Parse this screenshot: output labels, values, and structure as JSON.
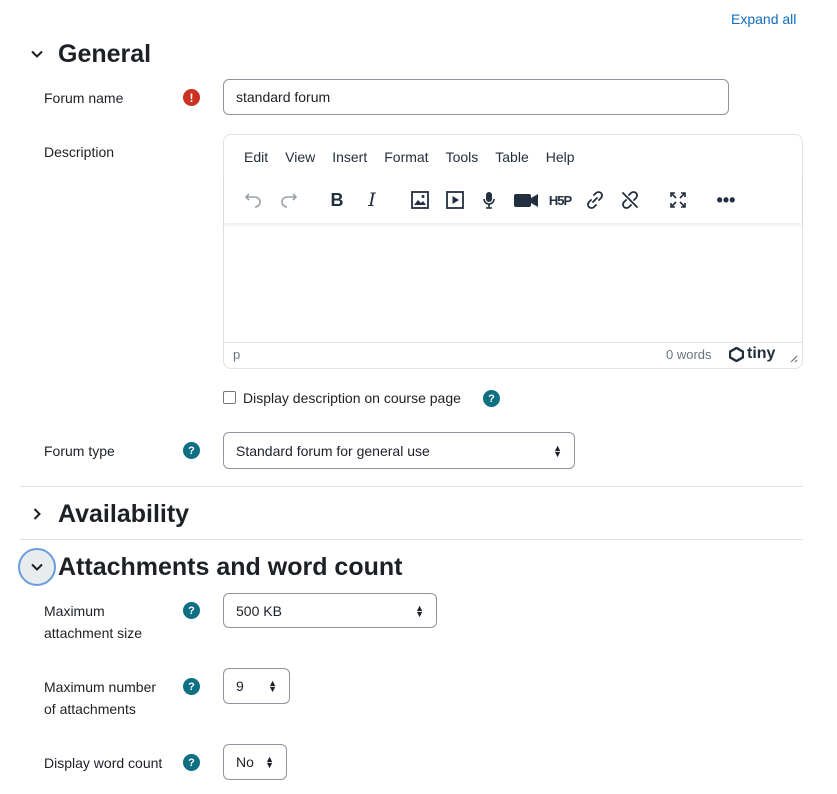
{
  "expand_all": "Expand all",
  "sections": {
    "general": {
      "title": "General"
    },
    "availability": {
      "title": "Availability"
    },
    "attachments": {
      "title": "Attachments and word count"
    }
  },
  "general": {
    "forum_name": {
      "label": "Forum name",
      "value": "standard forum"
    },
    "description": {
      "label": "Description",
      "menu": [
        "Edit",
        "View",
        "Insert",
        "Format",
        "Tools",
        "Table",
        "Help"
      ],
      "toolbar_icons": [
        "undo-icon",
        "redo-icon",
        "bold-icon",
        "italic-icon",
        "image-icon",
        "media-icon",
        "microphone-icon",
        "video-camera-icon",
        "h5p-icon",
        "link-icon",
        "unlink-icon",
        "fullscreen-icon",
        "more-icon"
      ],
      "status_path": "p",
      "word_count": "0 words",
      "brand": "tiny"
    },
    "display_description": {
      "label": "Display description on course page",
      "checked": false
    },
    "forum_type": {
      "label": "Forum type",
      "value": "Standard forum for general use"
    }
  },
  "attachments": {
    "max_size": {
      "label_line1": "Maximum",
      "label_line2": "attachment size",
      "value": "500 KB"
    },
    "max_number": {
      "label_line1": "Maximum number",
      "label_line2": "of attachments",
      "value": "9"
    },
    "word_count": {
      "label": "Display word count",
      "value": "No"
    }
  },
  "colors": {
    "link": "#0f6cbf",
    "help_icon": "#0f6f83",
    "required_icon": "#ca3120",
    "focus_ring": "#6b9ddc"
  }
}
